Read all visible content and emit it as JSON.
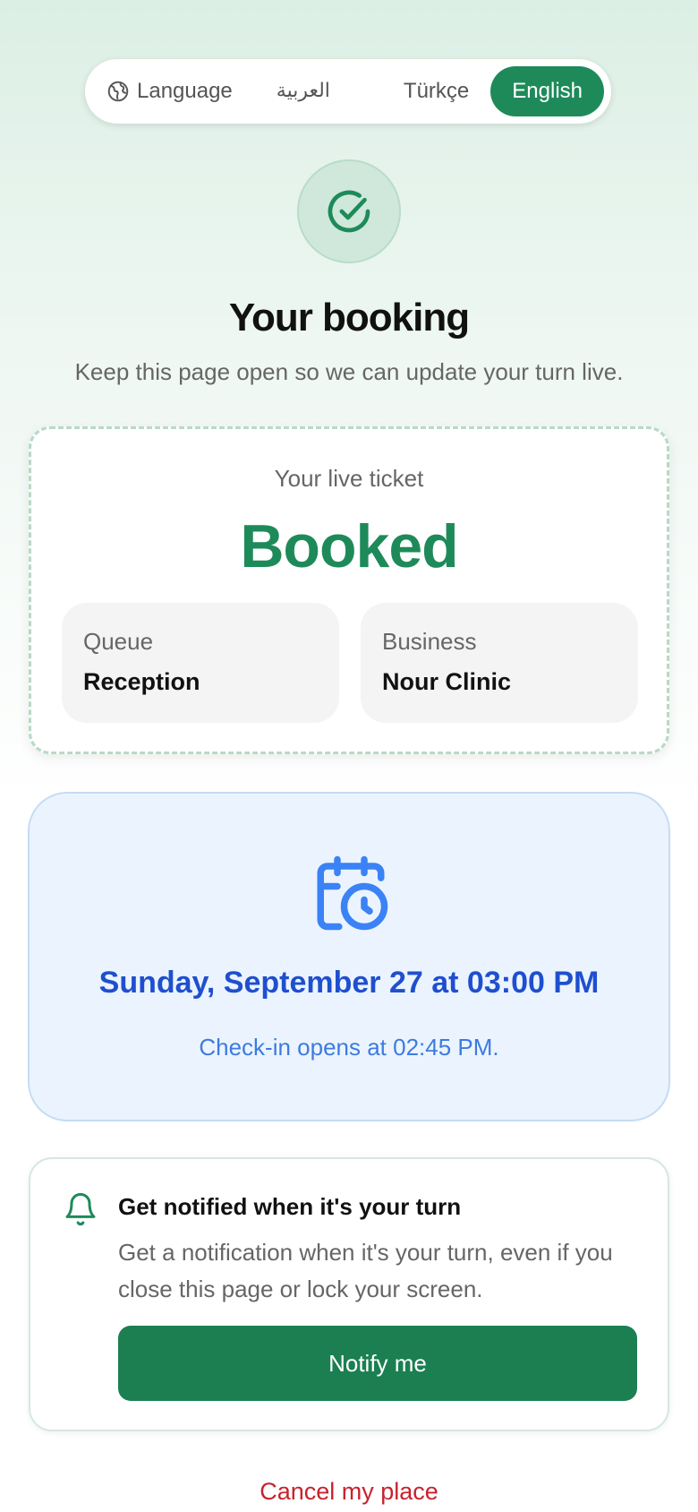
{
  "language_bar": {
    "label": "Language",
    "options": [
      "العربية",
      "Türkçe",
      "English"
    ],
    "selected": "English"
  },
  "header": {
    "title": "Your booking",
    "subtitle": "Keep this page open so we can update your turn live."
  },
  "ticket": {
    "label": "Your live ticket",
    "status": "Booked",
    "queue_label": "Queue",
    "queue_value": "Reception",
    "business_label": "Business",
    "business_value": "Nour Clinic"
  },
  "appointment": {
    "datetime": "Sunday, September 27 at 03:00 PM",
    "checkin_note": "Check-in opens at 02:45 PM."
  },
  "notify": {
    "title": "Get notified when it's your turn",
    "description": "Get a notification when it's your turn, even if you close this page or lock your screen.",
    "button_label": "Notify me"
  },
  "cancel_label": "Cancel my place",
  "colors": {
    "primary_green": "#1e8a5a",
    "button_green": "#1b7f52",
    "blue_text": "#1f4fcf",
    "blue_light_text": "#3d7be0",
    "blue_bg": "#ebf4fe",
    "cancel_red": "#c8222d"
  }
}
